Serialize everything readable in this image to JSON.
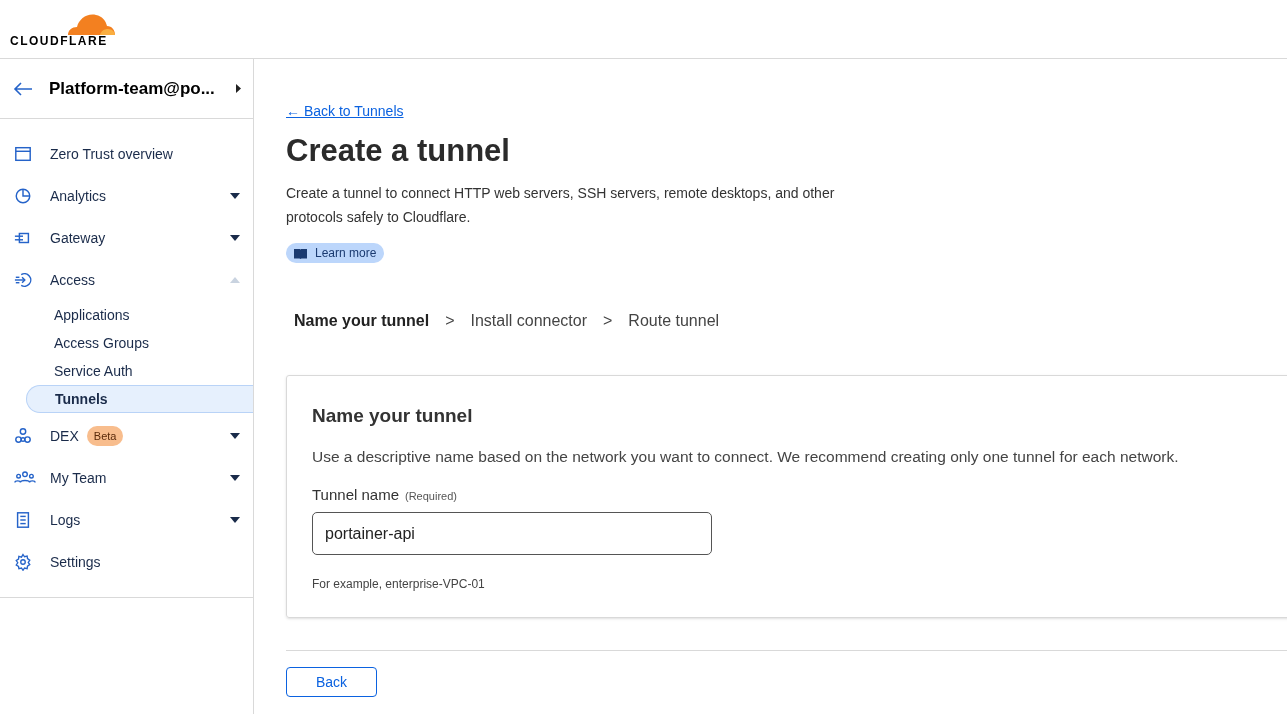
{
  "header": {
    "logo_text": "CLOUDFLARE"
  },
  "sidebar": {
    "account": "Platform-team@po...",
    "items": [
      {
        "label": "Zero Trust overview"
      },
      {
        "label": "Analytics",
        "expanded": false
      },
      {
        "label": "Gateway",
        "expanded": false
      },
      {
        "label": "Access",
        "expanded": true,
        "children": [
          {
            "label": "Applications",
            "selected": false
          },
          {
            "label": "Access Groups",
            "selected": false
          },
          {
            "label": "Service Auth",
            "selected": false
          },
          {
            "label": "Tunnels",
            "selected": true
          }
        ]
      },
      {
        "label": "DEX",
        "badge": "Beta",
        "expanded": false
      },
      {
        "label": "My Team",
        "expanded": false
      },
      {
        "label": "Logs",
        "expanded": false
      },
      {
        "label": "Settings"
      }
    ]
  },
  "page": {
    "back_link": "← Back to Tunnels",
    "title": "Create a tunnel",
    "description": "Create a tunnel to connect HTTP web servers, SSH servers, remote desktops, and other protocols safely to Cloudflare.",
    "learn_more": "Learn more",
    "steps": [
      {
        "label": "Name your tunnel",
        "selected": true
      },
      {
        "label": "Install connector",
        "selected": false
      },
      {
        "label": "Route tunnel",
        "selected": false
      }
    ],
    "step_separator": ">",
    "card": {
      "title": "Name your tunnel",
      "description": "Use a descriptive name based on the network you want to connect. We recommend creating only one tunnel for each network.",
      "field_label": "Tunnel name",
      "field_hint": "(Required)",
      "field_value": "portainer-api",
      "helper": "For example, enterprise-VPC-01"
    },
    "back_button": "Back"
  }
}
